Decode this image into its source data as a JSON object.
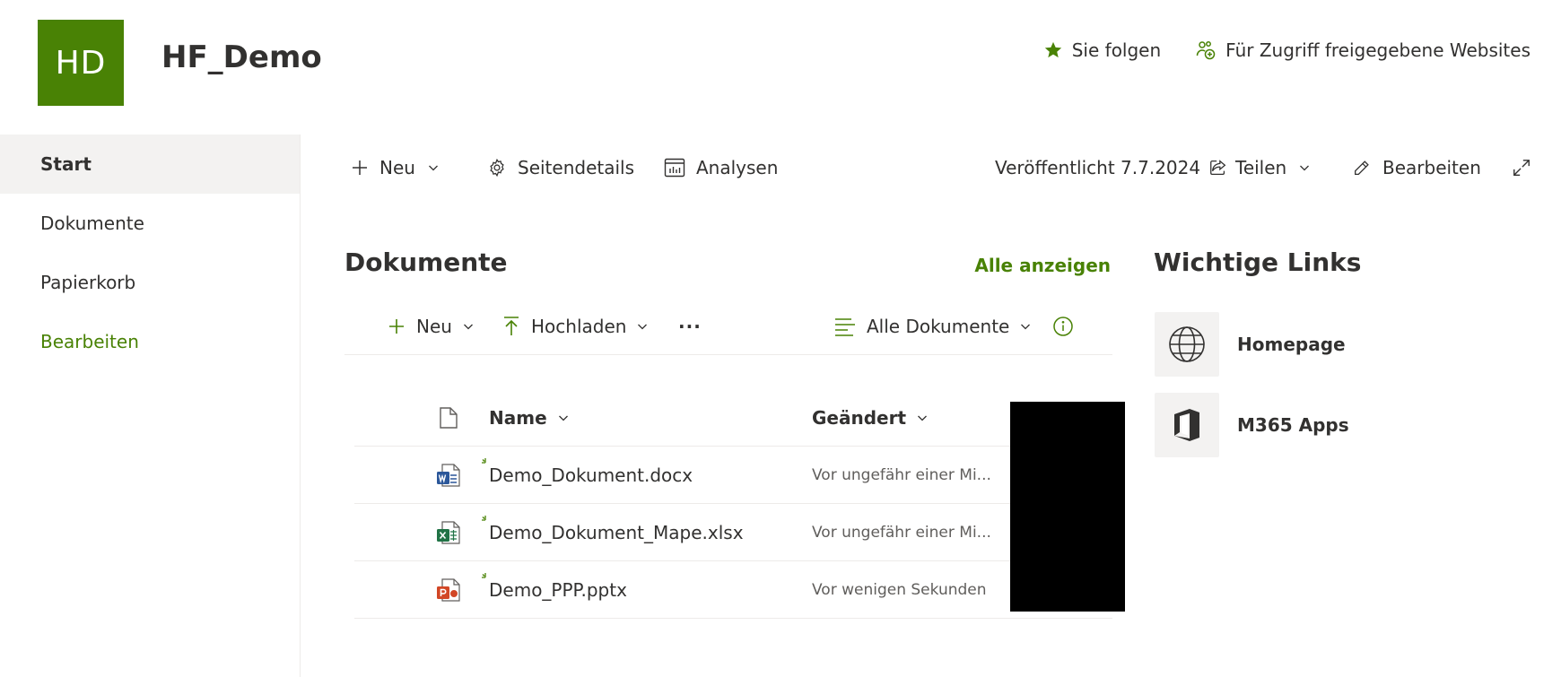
{
  "header": {
    "logo_initials": "HD",
    "site_title": "HF_Demo",
    "follow_label": "Sie folgen",
    "shared_sites_label": "Für Zugriff freigegebene Websites"
  },
  "nav": {
    "items": [
      {
        "label": "Start"
      },
      {
        "label": "Dokumente"
      },
      {
        "label": "Papierkorb"
      },
      {
        "label": "Bearbeiten"
      }
    ]
  },
  "command_bar": {
    "new_label": "Neu",
    "page_details_label": "Seitendetails",
    "analytics_label": "Analysen",
    "published_label": "Veröffentlicht 7.7.2024",
    "share_label": "Teilen",
    "edit_label": "Bearbeiten"
  },
  "documents": {
    "title": "Dokumente",
    "see_all_label": "Alle anzeigen",
    "toolbar": {
      "new_label": "Neu",
      "upload_label": "Hochladen",
      "more_label": "···",
      "view_label": "Alle Dokumente"
    },
    "columns": {
      "name": "Name",
      "modified": "Geändert"
    },
    "rows": [
      {
        "name": "Demo_Dokument.docx",
        "modified": "Vor ungefähr einer Mi...",
        "type": "word"
      },
      {
        "name": "Demo_Dokument_Mape.xlsx",
        "modified": "Vor ungefähr einer Mi...",
        "type": "excel"
      },
      {
        "name": "Demo_PPP.pptx",
        "modified": "Vor wenigen Sekunden",
        "type": "powerpoint"
      }
    ]
  },
  "quick_links": {
    "title": "Wichtige Links",
    "items": [
      {
        "label": "Homepage",
        "icon": "globe-icon"
      },
      {
        "label": "M365 Apps",
        "icon": "office-icon"
      }
    ]
  },
  "colors": {
    "accent": "#498205",
    "text": "#323130",
    "subtle_text": "#605e5c",
    "nav_active_bg": "#f3f2f1",
    "divider": "#edebe9"
  }
}
